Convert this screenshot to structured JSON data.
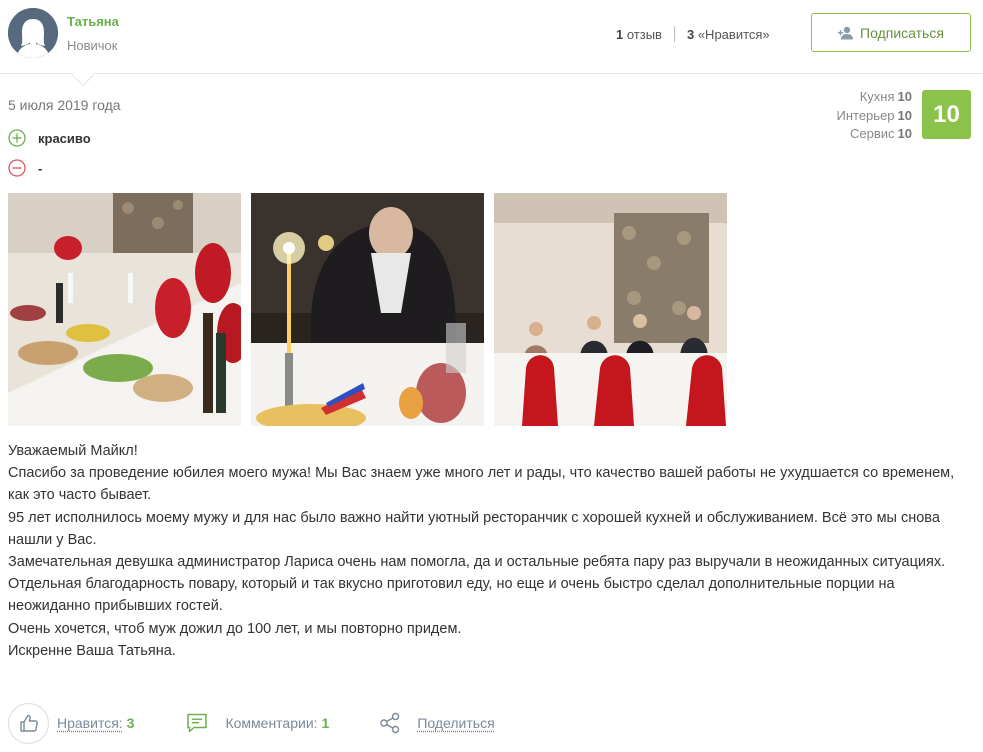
{
  "author": {
    "name": "Татьяна",
    "rank": "Новичок"
  },
  "stats": {
    "reviews_count": "1",
    "reviews_label": "отзыв",
    "likes_count": "3",
    "likes_label": "«Нравится»"
  },
  "subscribe_label": "Подписаться",
  "review": {
    "date": "5 июля 2019 года",
    "ratings": [
      {
        "label": "Кухня",
        "value": "10"
      },
      {
        "label": "Интерьер",
        "value": "10"
      },
      {
        "label": "Сервис",
        "value": "10"
      }
    ],
    "overall_score": "10",
    "pros": "красиво",
    "cons": "-",
    "paragraphs": [
      "Уважаемый Майкл!",
      "Спасибо за проведение юбилея моего мужа! Мы Вас знаем уже много лет и рады, что качество вашей работы не ухудшается со временем, как это часто бывает.",
      "95 лет исполнилось моему мужу и для нас было важно найти уютный ресторанчик с хорошей кухней и обслуживанием. Всё это мы снова нашли у Вас.",
      "Замечательная девушка администратор Лариса очень нам помогла, да и остальные ребята пару раз выручали в неожиданных ситуациях. Отдельная благодарность повару, который и так вкусно приготовил еду, но еще и очень быстро сделал дополнительные порции на неожиданно прибывших гостей.",
      "Очень хочется, чтоб муж дожил до 100 лет, и мы повторно придем.",
      "Искренне Ваша Татьяна."
    ]
  },
  "actions": {
    "like_label": "Нравится:",
    "like_count": "3",
    "comments_label": "Комментарии:",
    "comments_count": "1",
    "share_label": "Поделиться"
  },
  "colors": {
    "accent_green": "#8bc34a",
    "name_green": "#6ab04c",
    "cons_red": "#e05555",
    "link_gray": "#7a8a99"
  },
  "icons": [
    "avatar-placeholder-icon",
    "add-user-icon",
    "plus-circle-icon",
    "minus-circle-icon",
    "thumbs-up-icon",
    "comment-icon",
    "share-icon"
  ]
}
